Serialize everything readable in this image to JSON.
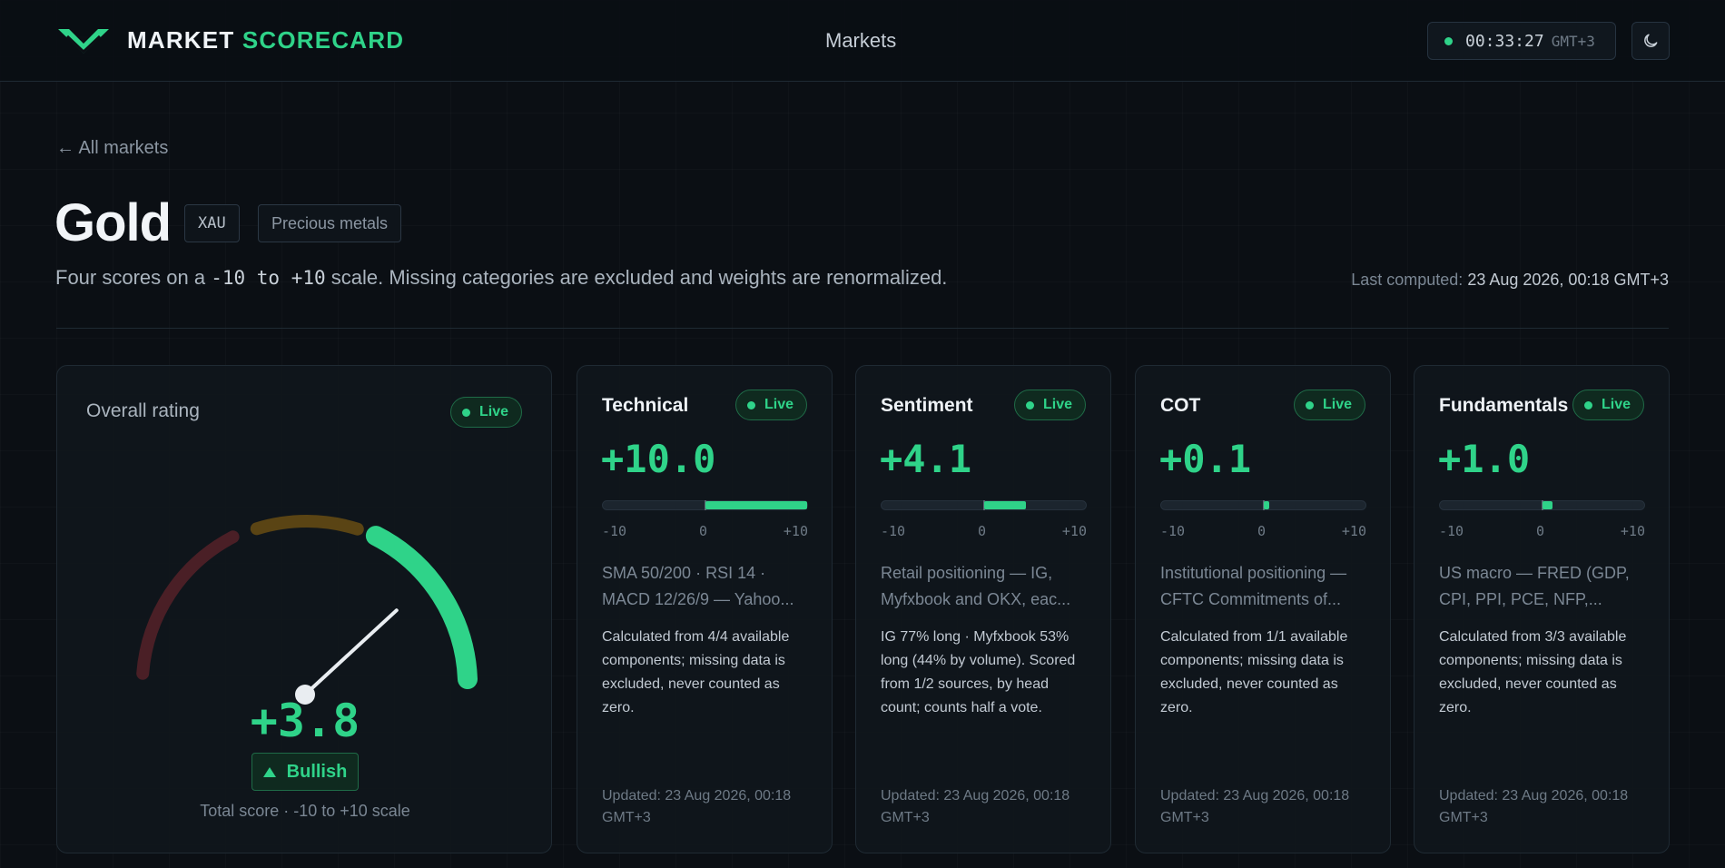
{
  "header": {
    "brand_part1": "MARKET",
    "brand_part2": "SCORECARD",
    "nav_label": "Markets",
    "clock_time": "00:33:27",
    "clock_tz": "GMT+3",
    "logo_icon": "w-chevron-logo-icon",
    "theme_icon": "moon-icon"
  },
  "page": {
    "back_label": "← All markets",
    "title": "Gold",
    "symbol": "XAU",
    "category": "Precious metals",
    "subtitle_before": "Four scores on a ",
    "subtitle_code": "-10 to +10",
    "subtitle_after": " scale. Missing categories are excluded and weights are renormalized.",
    "last_computed_label": "Last computed:",
    "last_computed_value": "23 Aug 2026, 00:18 GMT+3"
  },
  "overall": {
    "label": "Overall rating",
    "badge": "Live",
    "score_text": "+3.8",
    "score_value": 3.8,
    "verdict": "Bullish",
    "note": "Total score · -10 to +10 scale"
  },
  "categories": [
    {
      "name": "Technical",
      "badge": "Live",
      "score_text": "+10.0",
      "value": 10.0,
      "tick_min": "-10",
      "tick_zero": "0",
      "tick_max": "+10",
      "source": "SMA 50/200 · RSI 14 · MACD 12/26/9 — Yahoo...",
      "description": "Calculated from 4/4 available components; missing data is excluded, never counted as zero.",
      "updated": "Updated: 23 Aug 2026, 00:18 GMT+3"
    },
    {
      "name": "Sentiment",
      "badge": "Live",
      "score_text": "+4.1",
      "value": 4.1,
      "tick_min": "-10",
      "tick_zero": "0",
      "tick_max": "+10",
      "source": "Retail positioning — IG, Myfxbook and OKX, eac...",
      "description": "IG 77% long · Myfxbook 53% long (44% by volume). Scored from 1/2 sources, by head count; counts half a vote.",
      "updated": "Updated: 23 Aug 2026, 00:18 GMT+3"
    },
    {
      "name": "COT",
      "badge": "Live",
      "score_text": "+0.1",
      "value": 0.1,
      "tick_min": "-10",
      "tick_zero": "0",
      "tick_max": "+10",
      "source": "Institutional positioning — CFTC Commitments of...",
      "description": "Calculated from 1/1 available components; missing data is excluded, never counted as zero.",
      "updated": "Updated: 23 Aug 2026, 00:18 GMT+3"
    },
    {
      "name": "Fundamentals",
      "badge": "Live",
      "score_text": "+1.0",
      "value": 1.0,
      "tick_min": "-10",
      "tick_zero": "0",
      "tick_max": "+10",
      "source": "US macro — FRED (GDP, CPI, PPI, PCE, NFP,...",
      "description": "Calculated from 3/3 available components; missing data is excluded, never counted as zero.",
      "updated": "Updated: 23 Aug 2026, 00:18 GMT+3"
    }
  ],
  "colors": {
    "accent": "#2fd389",
    "bearish_dim": "#4a1f26",
    "neutral_dim": "#5a4414",
    "background": "#0b0f14"
  }
}
